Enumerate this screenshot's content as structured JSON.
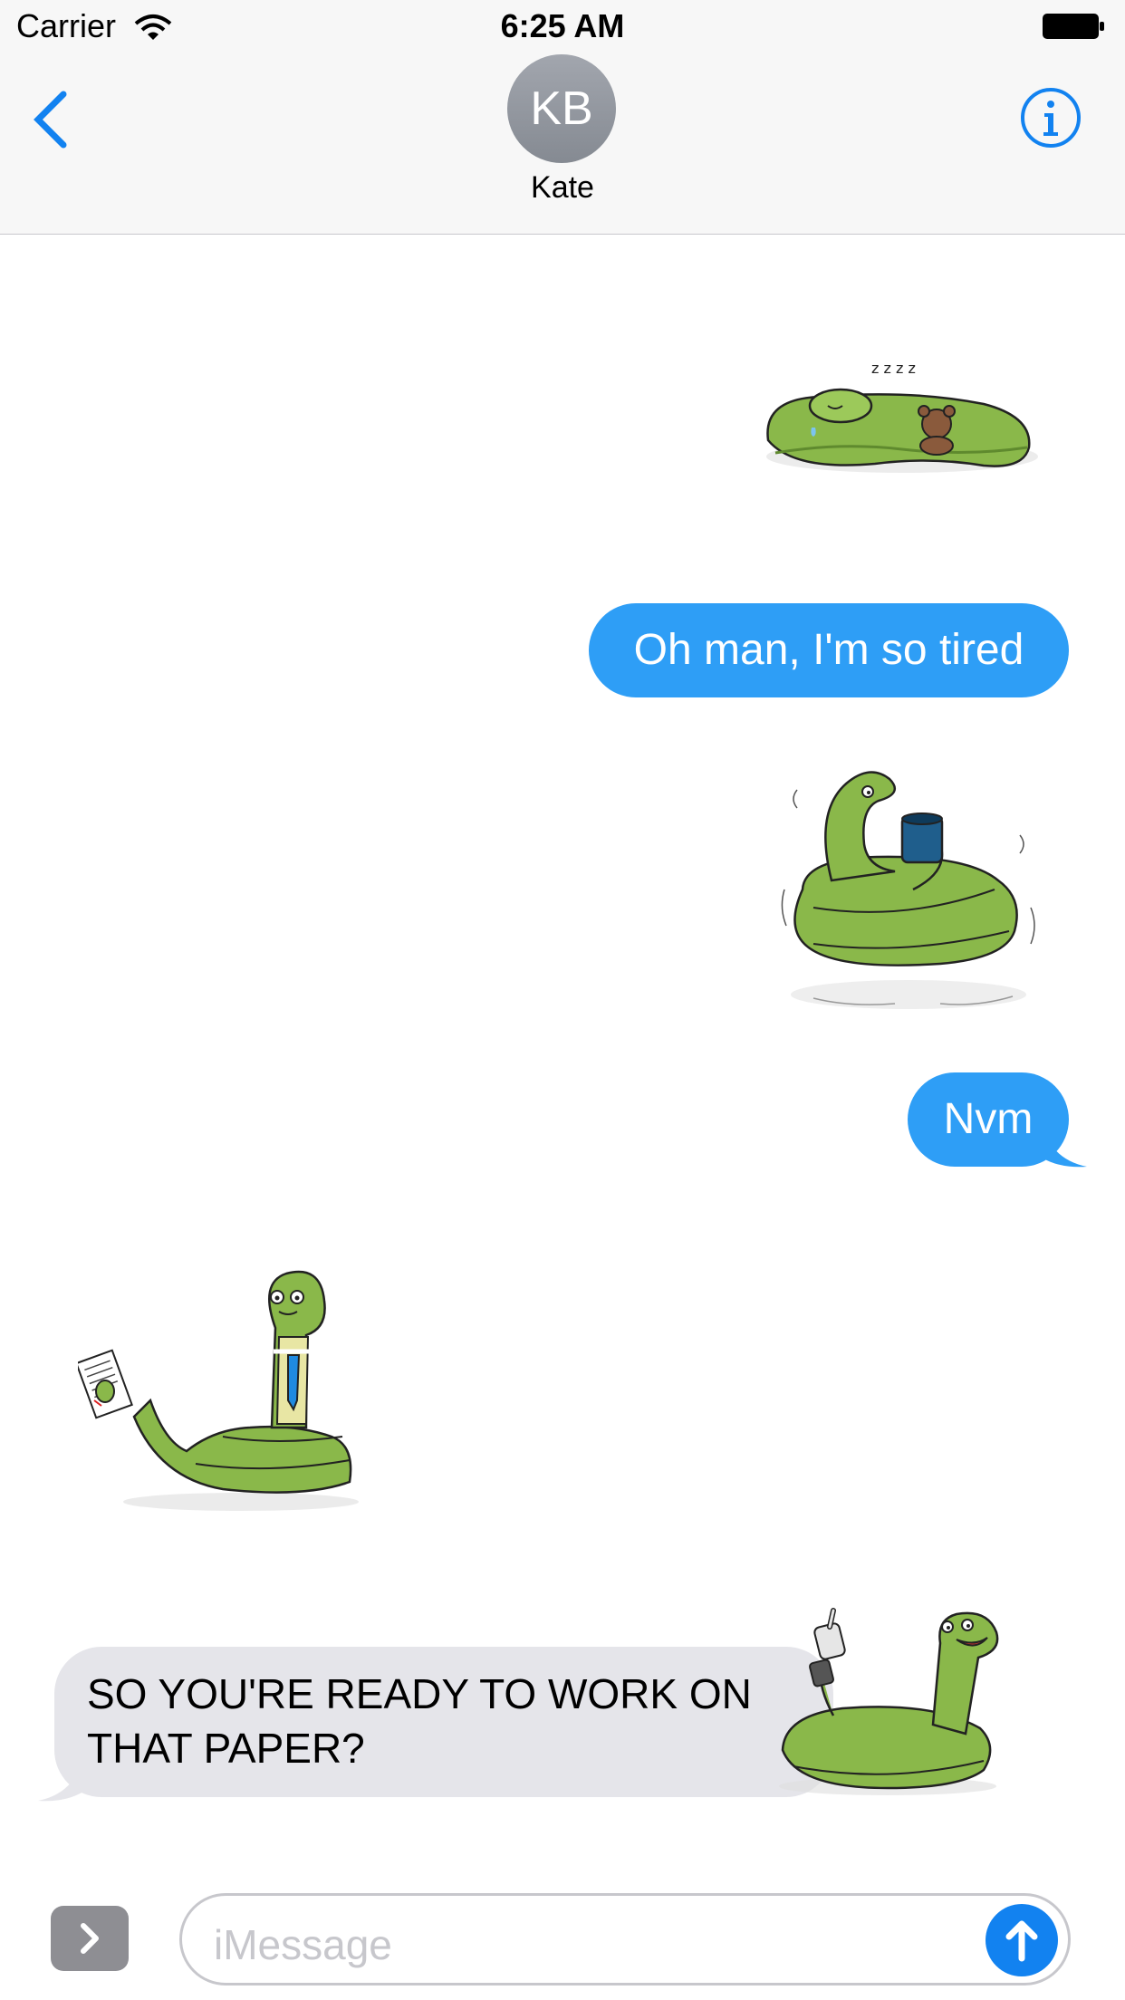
{
  "status_bar": {
    "carrier": "Carrier",
    "time": "6:25 AM"
  },
  "nav": {
    "avatar_initials": "KB",
    "contact_name": "Kate"
  },
  "messages": [
    {
      "from": "me",
      "kind": "sticker",
      "icon": "sleeping-snake-sticker"
    },
    {
      "from": "me",
      "kind": "text",
      "text": "Oh man, I'm so tired"
    },
    {
      "from": "me",
      "kind": "sticker",
      "icon": "coffee-snake-sticker"
    },
    {
      "from": "me",
      "kind": "text",
      "text": "Nvm"
    },
    {
      "from": "them",
      "kind": "sticker",
      "icon": "business-snake-sticker"
    },
    {
      "from": "them",
      "kind": "text",
      "text": "SO YOU'RE READY TO WORK ON THAT PAPER?"
    },
    {
      "from": "them",
      "kind": "sticker",
      "icon": "thumbs-up-snake-sticker"
    }
  ],
  "input": {
    "placeholder": "iMessage"
  },
  "colors": {
    "blue_bubble": "#2e9ef6",
    "gray_bubble": "#e5e5ea",
    "snake_green": "#8ab84a",
    "ios_blue": "#1282f0"
  }
}
